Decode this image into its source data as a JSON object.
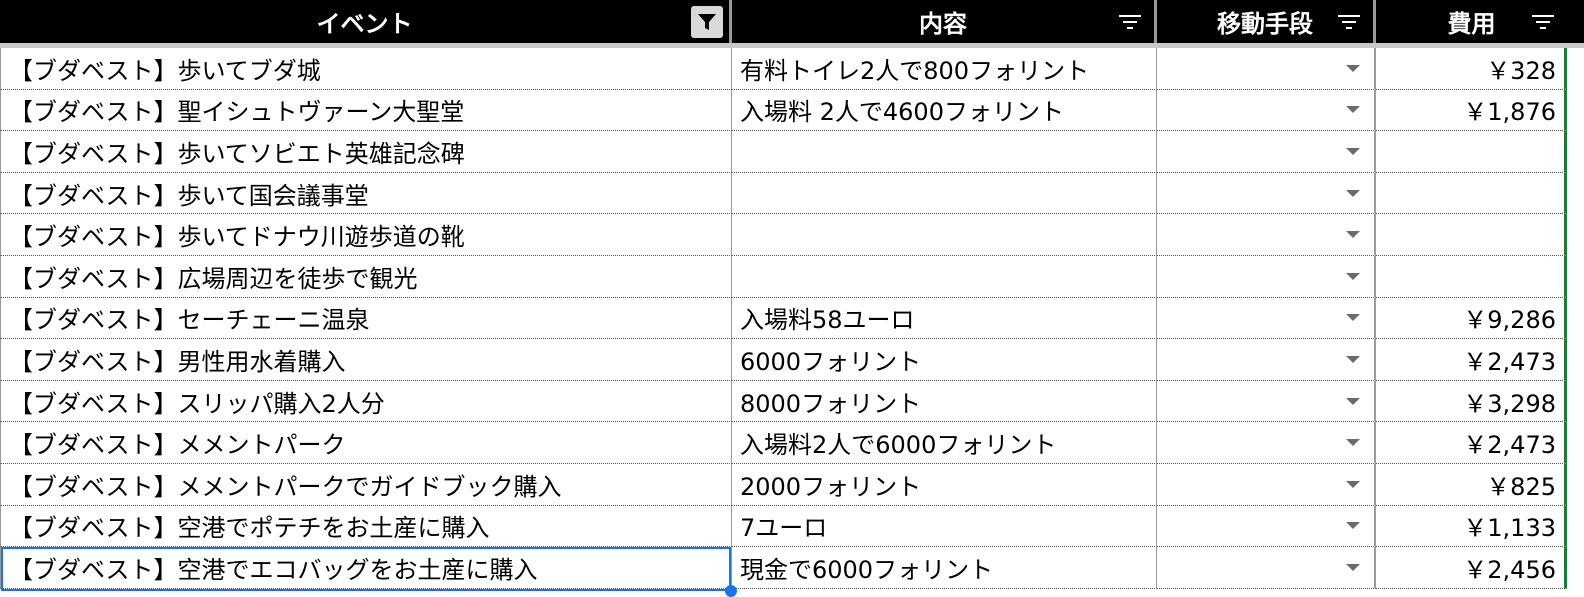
{
  "columns": [
    {
      "key": "event",
      "label": "イベント",
      "filter_active": true
    },
    {
      "key": "content",
      "label": "内容",
      "filter_active": false
    },
    {
      "key": "transport",
      "label": "移動手段",
      "filter_active": false
    },
    {
      "key": "cost",
      "label": "費用",
      "filter_active": false
    }
  ],
  "rows": [
    {
      "event": "【ブダベスト】歩いてブダ城",
      "content": "有料トイレ2人で800フォリント",
      "transport": "",
      "cost": "￥328"
    },
    {
      "event": "【ブダベスト】聖イシュトヴァーン大聖堂",
      "content": "入場料 2人で4600フォリント",
      "transport": "",
      "cost": "￥1,876"
    },
    {
      "event": "【ブダベスト】歩いてソビエト英雄記念碑",
      "content": "",
      "transport": "",
      "cost": ""
    },
    {
      "event": "【ブダベスト】歩いて国会議事堂",
      "content": "",
      "transport": "",
      "cost": ""
    },
    {
      "event": "【ブダベスト】歩いてドナウ川遊歩道の靴",
      "content": "",
      "transport": "",
      "cost": ""
    },
    {
      "event": "【ブダベスト】広場周辺を徒歩で観光",
      "content": "",
      "transport": "",
      "cost": ""
    },
    {
      "event": "【ブダベスト】セーチェーニ温泉",
      "content": "入場料58ユーロ",
      "transport": "",
      "cost": "￥9,286"
    },
    {
      "event": "【ブダベスト】男性用水着購入",
      "content": "6000フォリント",
      "transport": "",
      "cost": "￥2,473"
    },
    {
      "event": "【ブダベスト】スリッパ購入2人分",
      "content": "8000フォリント",
      "transport": "",
      "cost": "￥3,298"
    },
    {
      "event": "【ブダベスト】メメントパーク",
      "content": "入場料2人で6000フォリント",
      "transport": "",
      "cost": "￥2,473"
    },
    {
      "event": "【ブダベスト】メメントパークでガイドブック購入",
      "content": "2000フォリント",
      "transport": "",
      "cost": "￥825"
    },
    {
      "event": "【ブダベスト】空港でポテチをお土産に購入",
      "content": "7ユーロ",
      "transport": "",
      "cost": "￥1,133"
    },
    {
      "event": "【ブダベスト】空港でエコバッグをお土産に購入",
      "content": "現金で6000フォリント",
      "transport": "",
      "cost": "￥2,456"
    }
  ],
  "selected_row_index": 12,
  "colors": {
    "header_bg": "#000000",
    "header_text": "#ffffff",
    "selection": "#1a73e8",
    "grid_green": "#1e7b34"
  }
}
